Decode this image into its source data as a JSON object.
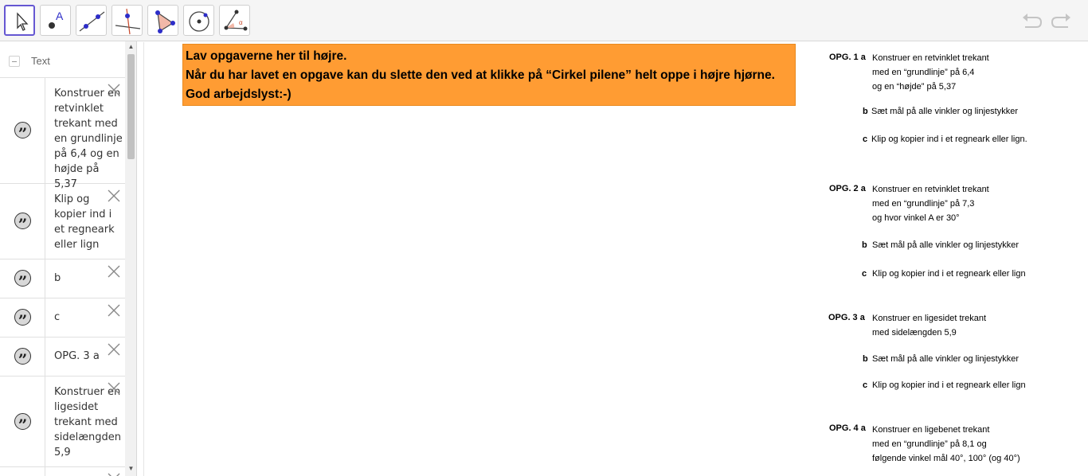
{
  "toolbar": {
    "tools": [
      {
        "name": "move-tool",
        "selected": true
      },
      {
        "name": "point-tool"
      },
      {
        "name": "line-tool"
      },
      {
        "name": "perpendicular-line-tool"
      },
      {
        "name": "polygon-tool"
      },
      {
        "name": "circle-tool"
      },
      {
        "name": "angle-tool"
      }
    ],
    "undo_icon": "undo-icon",
    "redo_icon": "redo-icon"
  },
  "algebra": {
    "header_label": "Text",
    "rows": [
      {
        "text": "Konstruer en retvinklet trekant med en grundlinje på 6,4 og en højde på 5,37"
      },
      {
        "text": "Klip og kopier ind i et regneark eller lign"
      },
      {
        "text": "b"
      },
      {
        "text": "c"
      },
      {
        "text": "OPG. 3 a"
      },
      {
        "text": "Konstruer en ligesidet trekant med sidelængden 5,9"
      }
    ]
  },
  "banner": {
    "line1": "Lav opgaverne her til højre.",
    "line2": "Når du har lavet en opgave kan du slette den ved at klikke på “Cirkel pilene” helt oppe i højre hjørne.",
    "line3": "God arbejdslyst:-)",
    "color": "#ff9c33"
  },
  "tasks": {
    "opg1": {
      "label": "OPG. 1 a",
      "a1": "Konstruer en retvinklet trekant",
      "a2": "med en “grundlinje” på 6,4",
      "a3": "og en “højde” på 5,37",
      "b_label": "b",
      "b": "Sæt mål på alle vinkler og linjestykker",
      "c_label": "c",
      "c": "Klip og kopier ind i et regneark eller lign."
    },
    "opg2": {
      "label": "OPG. 2 a",
      "a1": "Konstruer en retvinklet trekant",
      "a2": "med en “grundlinje” på 7,3",
      "a3": "og hvor vinkel A er 30°",
      "b_label": "b",
      "b": "Sæt mål på alle vinkler og linjestykker",
      "c_label": "c",
      "c": "Klip og kopier ind i et regneark eller lign"
    },
    "opg3": {
      "label": "OPG. 3 a",
      "a1": "Konstruer en ligesidet trekant",
      "a2": "med sidelængden 5,9",
      "b_label": "b",
      "b": "Sæt mål på alle vinkler og linjestykker",
      "c_label": "c",
      "c": "Klip og kopier ind i et regneark eller lign"
    },
    "opg4": {
      "label": "OPG. 4 a",
      "a1": "Konstruer en ligebenet trekant",
      "a2": "med en “grundlinje” på 8,1 og",
      "a3": "følgende vinkel mål 40°, 100° (og 40°)"
    }
  }
}
